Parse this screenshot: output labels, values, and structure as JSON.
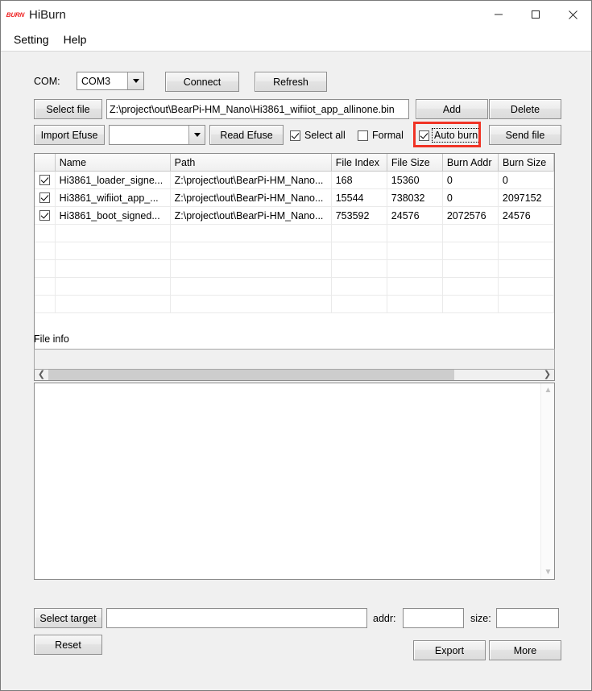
{
  "window": {
    "logo_text": "BURN",
    "title": "HiBurn",
    "minimize_icon": "minimize-icon",
    "maximize_icon": "maximize-icon",
    "close_icon": "close-icon"
  },
  "menubar": {
    "items": [
      {
        "label": "Setting"
      },
      {
        "label": "Help"
      }
    ]
  },
  "toolbar": {
    "com_label": "COM:",
    "com_value": "COM3",
    "connect_label": "Connect",
    "refresh_label": "Refresh",
    "select_file_label": "Select file",
    "file_path_value": "Z:\\project\\out\\BearPi-HM_Nano\\Hi3861_wifiiot_app_allinone.bin",
    "add_label": "Add",
    "delete_label": "Delete",
    "import_efuse_label": "Import Efuse",
    "efuse_combo_value": "",
    "read_efuse_label": "Read Efuse",
    "select_all_label": "Select all",
    "select_all_checked": true,
    "formal_label": "Formal",
    "formal_checked": false,
    "auto_burn_label": "Auto burn",
    "auto_burn_checked": true,
    "auto_burn_highlight_color": "#f03325",
    "send_file_label": "Send file"
  },
  "file_table": {
    "columns": [
      "",
      "Name",
      "Path",
      "File Index",
      "File Size",
      "Burn Addr",
      "Burn Size"
    ],
    "rows": [
      {
        "checked": true,
        "name": "Hi3861_loader_signe...",
        "path": "Z:\\project\\out\\BearPi-HM_Nano...",
        "file_index": "168",
        "file_size": "15360",
        "burn_addr": "0",
        "burn_size": "0"
      },
      {
        "checked": true,
        "name": "Hi3861_wifiiot_app_...",
        "path": "Z:\\project\\out\\BearPi-HM_Nano...",
        "file_index": "15544",
        "file_size": "738032",
        "burn_addr": "0",
        "burn_size": "2097152"
      },
      {
        "checked": true,
        "name": "Hi3861_boot_signed...",
        "path": "Z:\\project\\out\\BearPi-HM_Nano...",
        "file_index": "753592",
        "file_size": "24576",
        "burn_addr": "2072576",
        "burn_size": "24576"
      }
    ],
    "empty_row_count": 5,
    "hscroll_left_icon": "chevron-left-icon",
    "hscroll_right_icon": "chevron-right-icon"
  },
  "file_info": {
    "label": "File info",
    "value": ""
  },
  "log": {
    "value": "",
    "scroll_up_icon": "chevron-up-icon",
    "scroll_down_icon": "chevron-down-icon"
  },
  "footer": {
    "select_target_label": "Select target",
    "target_value": "",
    "addr_label": "addr:",
    "addr_value": "",
    "size_label": "size:",
    "size_value": "",
    "reset_label": "Reset",
    "export_label": "Export",
    "more_label": "More"
  }
}
